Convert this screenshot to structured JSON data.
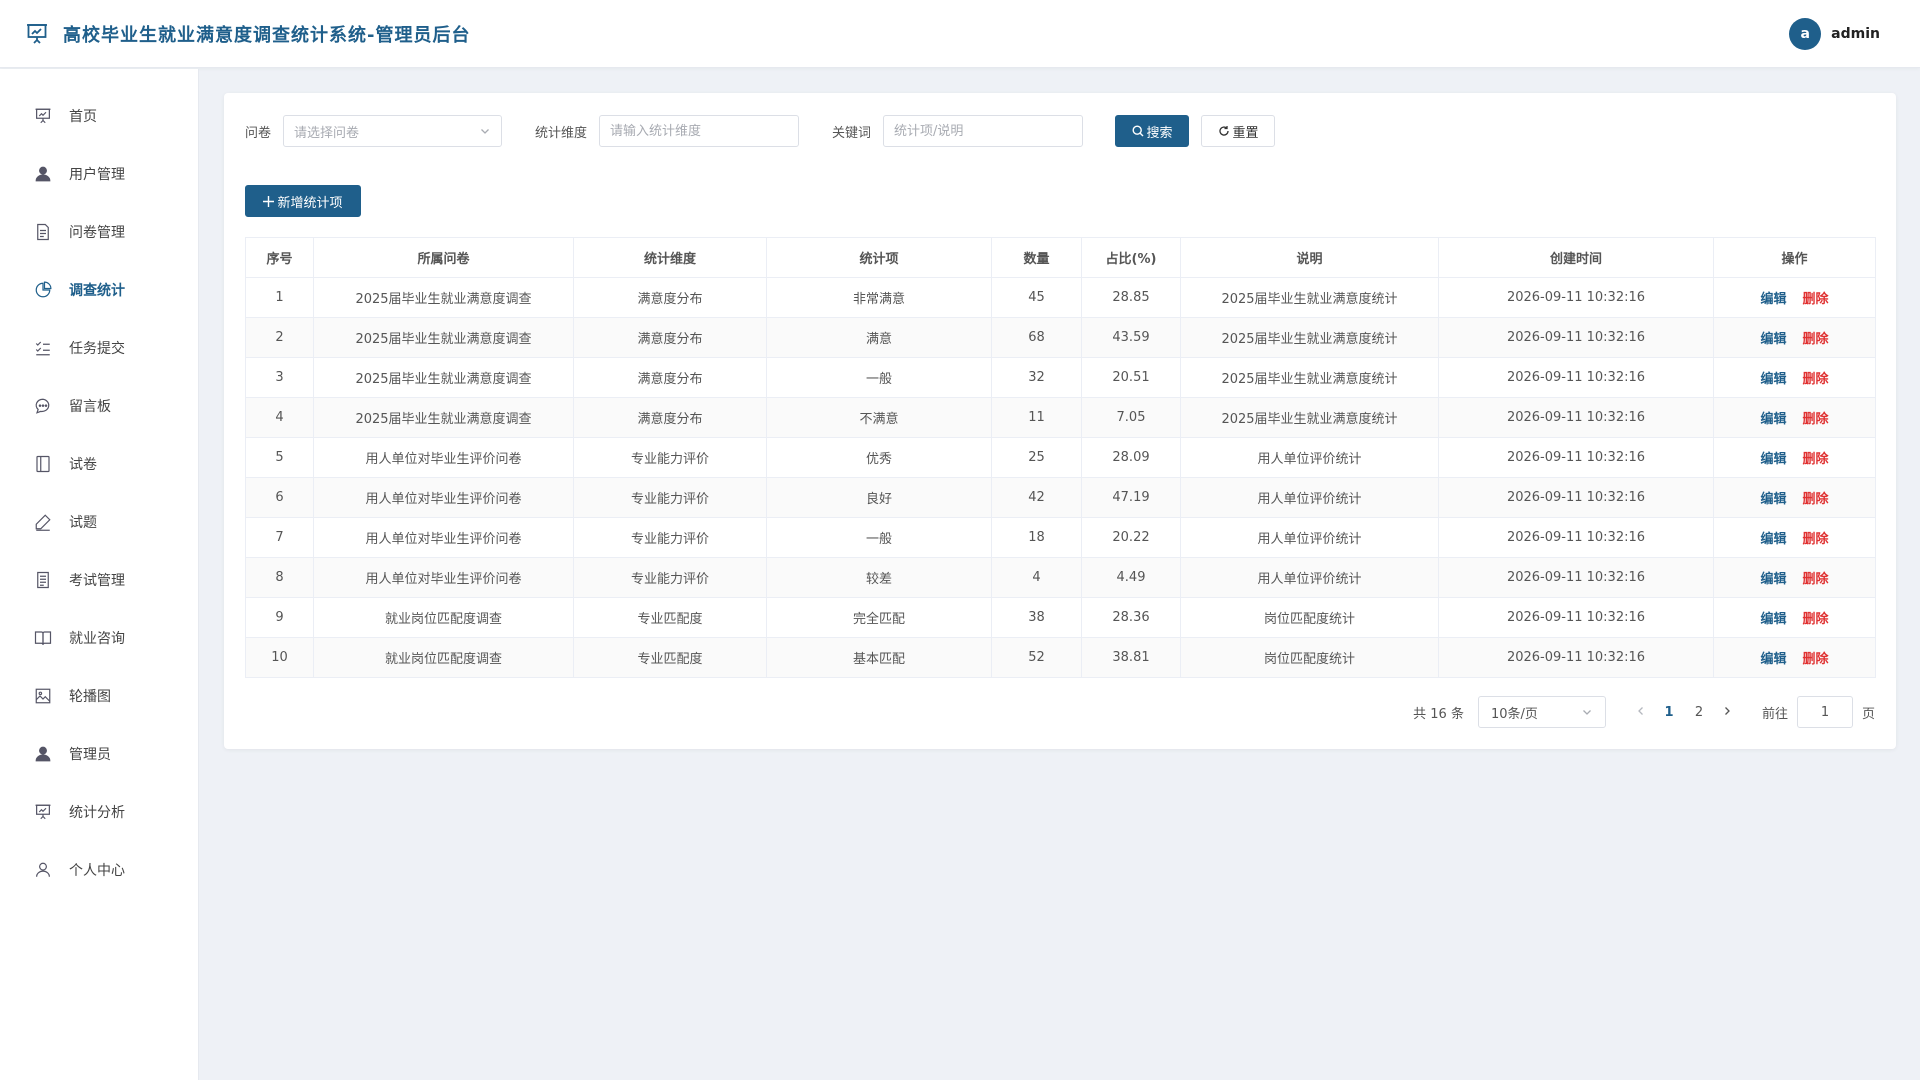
{
  "header": {
    "title": "高校毕业生就业满意度调查统计系统-管理员后台",
    "avatar_letter": "a",
    "username": "admin",
    "brand_icon": "presentation-icon"
  },
  "sidebar": {
    "items": [
      {
        "label": "首页",
        "icon": "presentation-icon"
      },
      {
        "label": "用户管理",
        "icon": "user-icon"
      },
      {
        "label": "问卷管理",
        "icon": "document-icon"
      },
      {
        "label": "调查统计",
        "icon": "pie-chart-icon",
        "active": true
      },
      {
        "label": "任务提交",
        "icon": "checklist-icon"
      },
      {
        "label": "留言板",
        "icon": "chat-icon"
      },
      {
        "label": "试卷",
        "icon": "notebook-icon"
      },
      {
        "label": "试题",
        "icon": "pen-icon"
      },
      {
        "label": "考试管理",
        "icon": "list-document-icon"
      },
      {
        "label": "就业咨询",
        "icon": "book-icon"
      },
      {
        "label": "轮播图",
        "icon": "image-icon"
      },
      {
        "label": "管理员",
        "icon": "user-icon"
      },
      {
        "label": "统计分析",
        "icon": "presentation-icon"
      },
      {
        "label": "个人中心",
        "icon": "user-outline-icon"
      }
    ]
  },
  "filters": {
    "questionnaire_label": "问卷",
    "questionnaire_placeholder": "请选择问卷",
    "dimension_label": "统计维度",
    "dimension_placeholder": "请输入统计维度",
    "keyword_label": "关键词",
    "keyword_placeholder": "统计项/说明",
    "search_label": "搜索",
    "reset_label": "重置"
  },
  "toolbar": {
    "add_label": "新增统计项"
  },
  "table": {
    "columns": [
      "序号",
      "所属问卷",
      "统计维度",
      "统计项",
      "数量",
      "占比(%)",
      "说明",
      "创建时间",
      "操作"
    ],
    "edit_label": "编辑",
    "delete_label": "删除",
    "rows": [
      [
        "1",
        "2025届毕业生就业满意度调查",
        "满意度分布",
        "非常满意",
        "45",
        "28.85",
        "2025届毕业生就业满意度统计",
        "2026-09-11 10:32:16"
      ],
      [
        "2",
        "2025届毕业生就业满意度调查",
        "满意度分布",
        "满意",
        "68",
        "43.59",
        "2025届毕业生就业满意度统计",
        "2026-09-11 10:32:16"
      ],
      [
        "3",
        "2025届毕业生就业满意度调查",
        "满意度分布",
        "一般",
        "32",
        "20.51",
        "2025届毕业生就业满意度统计",
        "2026-09-11 10:32:16"
      ],
      [
        "4",
        "2025届毕业生就业满意度调查",
        "满意度分布",
        "不满意",
        "11",
        "7.05",
        "2025届毕业生就业满意度统计",
        "2026-09-11 10:32:16"
      ],
      [
        "5",
        "用人单位对毕业生评价问卷",
        "专业能力评价",
        "优秀",
        "25",
        "28.09",
        "用人单位评价统计",
        "2026-09-11 10:32:16"
      ],
      [
        "6",
        "用人单位对毕业生评价问卷",
        "专业能力评价",
        "良好",
        "42",
        "47.19",
        "用人单位评价统计",
        "2026-09-11 10:32:16"
      ],
      [
        "7",
        "用人单位对毕业生评价问卷",
        "专业能力评价",
        "一般",
        "18",
        "20.22",
        "用人单位评价统计",
        "2026-09-11 10:32:16"
      ],
      [
        "8",
        "用人单位对毕业生评价问卷",
        "专业能力评价",
        "较差",
        "4",
        "4.49",
        "用人单位评价统计",
        "2026-09-11 10:32:16"
      ],
      [
        "9",
        "就业岗位匹配度调查",
        "专业匹配度",
        "完全匹配",
        "38",
        "28.36",
        "岗位匹配度统计",
        "2026-09-11 10:32:16"
      ],
      [
        "10",
        "就业岗位匹配度调查",
        "专业匹配度",
        "基本匹配",
        "52",
        "38.81",
        "岗位匹配度统计",
        "2026-09-11 10:32:16"
      ]
    ]
  },
  "pagination": {
    "total_text": "共 16 条",
    "page_size": "10条/页",
    "pages": [
      "1",
      "2"
    ],
    "current_page": "1",
    "goto_label": "前往",
    "goto_value": "1",
    "page_suffix": "页"
  },
  "colors": {
    "accent": "#1f5f8b",
    "danger": "#e03131"
  }
}
